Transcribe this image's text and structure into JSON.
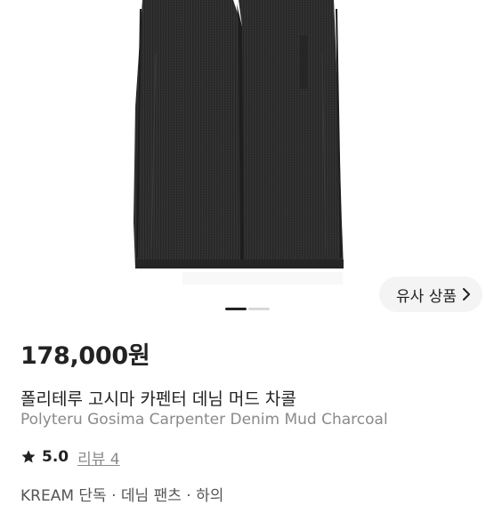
{
  "product": {
    "price": "178,000원",
    "name_ko": "폴리테루 고시마 카펜터 데님 머드 차콜",
    "name_en": "Polyteru Gosima Carpenter Denim Mud Charcoal"
  },
  "gallery": {
    "similar_button_label": "유사 상품",
    "current_index": 1,
    "total_images": 2
  },
  "rating": {
    "value": "5.0",
    "review_label": "리뷰 4"
  },
  "tags_line": "KREAM 단독 · 데님 팬츠 · 하의",
  "colors": {
    "denim": "#2e2e2e",
    "text_primary": "#222222",
    "text_secondary": "#8a8a8a"
  }
}
